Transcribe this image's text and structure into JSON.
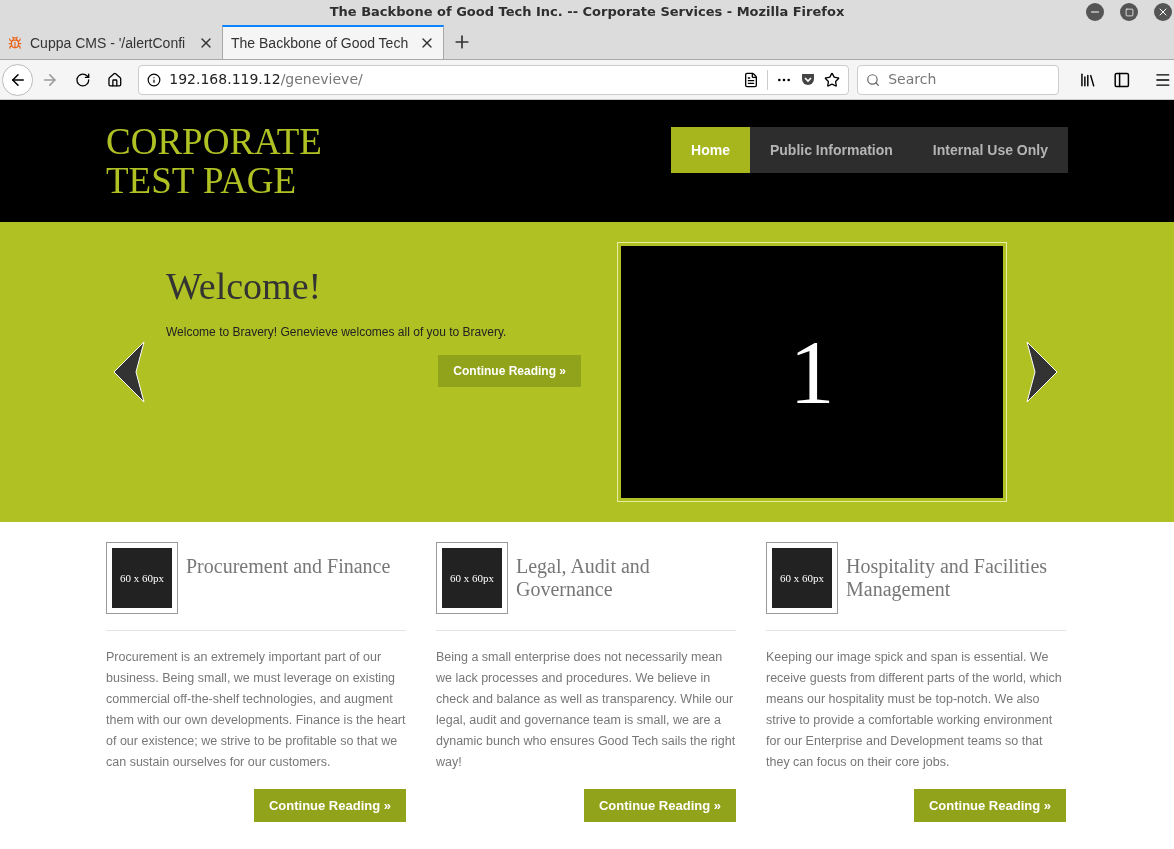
{
  "window": {
    "title": "The Backbone of Good Tech Inc. -- Corporate Services - Mozilla Firefox"
  },
  "tabs": [
    {
      "label": "Cuppa CMS - '/alertConfi",
      "selected": false
    },
    {
      "label": "The Backbone of Good Tech",
      "selected": true
    }
  ],
  "address_bar": {
    "host": "192.168.119.12",
    "path": "/genevieve/"
  },
  "search": {
    "placeholder": "Search"
  },
  "page": {
    "logo": [
      "CORPORATE",
      "TEST PAGE"
    ],
    "nav": [
      {
        "label": "Home",
        "selected": true
      },
      {
        "label": "Public Information",
        "selected": false
      },
      {
        "label": "Internal Use Only",
        "selected": false
      }
    ],
    "slider": {
      "heading": "Welcome!",
      "text": "Welcome to Bravery! Genevieve welcomes all of you to Bravery.",
      "button": "Continue Reading »",
      "slide_number": "1"
    },
    "cards": [
      {
        "thumb": "60 x 60px",
        "title": "Procurement and Finance",
        "text": "Procurement is an extremely important part of our business. Being small, we must leverage on existing commercial off-the-shelf technologies, and augment them with our own developments. Finance is the heart of our existence; we strive to be profitable so that we can sustain ourselves for our customers.",
        "button": "Continue Reading »"
      },
      {
        "thumb": "60 x 60px",
        "title": "Legal, Audit and Governance",
        "text": "Being a small enterprise does not necessarily mean we lack processes and procedures. We believe in check and balance as well as transparency. While our legal, audit and governance team is small, we are a dynamic bunch who ensures Good Tech sails the right way!",
        "button": "Continue Reading »"
      },
      {
        "thumb": "60 x 60px",
        "title": "Hospitality and Facilities Management",
        "text": "Keeping our image spick and span is essential. We receive guests from different parts of the world, which means our hospitality must be top-notch. We also strive to provide a comfortable working environment for our Enterprise and Development teams so that they can focus on their core jobs.",
        "button": "Continue Reading »"
      }
    ]
  }
}
